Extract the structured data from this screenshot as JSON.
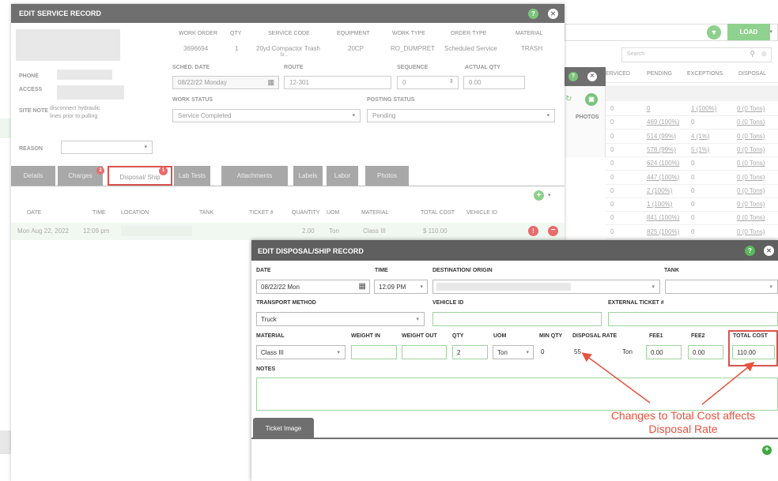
{
  "bg_panel": {
    "load_label": "LOAD",
    "search_placeholder": "Search",
    "columns": [
      "ERVICED",
      "PENDING",
      "EXCEPTIONS",
      "DISPOSAL"
    ],
    "photos_label": "PHOTOS",
    "rows": [
      {
        "serviced": "0",
        "pending": "0",
        "exceptions": "1 (100%)",
        "disposal": "0 (0 Tons)"
      },
      {
        "serviced": "0",
        "pending": "469 (100%)",
        "exceptions": "0",
        "disposal": "0 (0 Tons)"
      },
      {
        "serviced": "0",
        "pending": "514 (99%)",
        "exceptions": "4 (1%)",
        "disposal": "0 (0 Tons)"
      },
      {
        "serviced": "0",
        "pending": "578 (99%)",
        "exceptions": "5 (1%)",
        "disposal": "0 (0 Tons)"
      },
      {
        "serviced": "0",
        "pending": "624 (100%)",
        "exceptions": "0",
        "disposal": "0 (0 Tons)"
      },
      {
        "serviced": "0",
        "pending": "447 (100%)",
        "exceptions": "0",
        "disposal": "0 (0 Tons)"
      },
      {
        "serviced": "0",
        "pending": "2 (100%)",
        "exceptions": "0",
        "disposal": "0 (0 Tons)"
      },
      {
        "serviced": "0",
        "pending": "1 (100%)",
        "exceptions": "0",
        "disposal": "0 (0 Tons)"
      },
      {
        "serviced": "0",
        "pending": "841 (100%)",
        "exceptions": "0",
        "disposal": "0 (0 Tons)"
      },
      {
        "serviced": "0",
        "pending": "825 (100%)",
        "exceptions": "0",
        "disposal": "0 (0 Tons)"
      }
    ]
  },
  "service_record": {
    "title": "EDIT SERVICE RECORD",
    "help": "?",
    "close": "✕",
    "headers": {
      "work_order": "WORK ORDER",
      "qty": "QTY",
      "service_code": "SERVICE CODE",
      "equipment": "EQUIPMENT",
      "work_type": "WORK TYPE",
      "order_type": "ORDER TYPE",
      "material": "MATERIAL"
    },
    "values": {
      "work_order": "3696694",
      "qty": "1",
      "service_code": "20yd Compactor Trash",
      "service_code_2": "Sr...",
      "equipment": "20CP",
      "work_type": "RO_DUMPRET",
      "order_type": "Scheduled Service",
      "material": "TRASH"
    },
    "phone_label": "PHONE",
    "access_label": "ACCESS",
    "site_note_label": "SITE NOTE",
    "site_note_1": "disconnect hydraulic",
    "site_note_2": "lines prior to pulling",
    "reason_label": "REASON",
    "sched_date_label": "SCHED. DATE",
    "sched_date": "08/22/22 Monday",
    "route_label": "ROUTE",
    "route": "12-301",
    "sequence_label": "SEQUENCE",
    "sequence": "0",
    "actual_qty_label": "ACTUAL QTY",
    "actual_qty": "0.00",
    "work_status_label": "WORK STATUS",
    "work_status": "Service Completed",
    "posting_status_label": "POSTING STATUS",
    "posting_status": "Pending",
    "tabs": [
      {
        "label": "Details"
      },
      {
        "label": "Charges",
        "badge": "2"
      },
      {
        "label": "Disposal/ Ship",
        "badge": "1"
      },
      {
        "label": "Lab Tests"
      },
      {
        "label": "Attachments"
      },
      {
        "label": "Labels"
      },
      {
        "label": "Labor"
      },
      {
        "label": "Photos"
      }
    ],
    "table": {
      "headers": [
        "DATE",
        "TIME",
        "LOCATION",
        "TANK",
        "TICKET #",
        "QUANTITY",
        "UOM",
        "MATERIAL",
        "TOTAL COST",
        "VEHICLE ID"
      ],
      "row": {
        "date": "Mon Aug 22, 2022",
        "time": "12:09 pm",
        "quantity": "2.00",
        "uom": "Ton",
        "material": "Class III",
        "total_cost": "$ 110.00"
      }
    }
  },
  "disposal_record": {
    "title": "EDIT DISPOSAL/SHIP RECORD",
    "help": "?",
    "close": "✕",
    "date_label": "DATE",
    "date": "08/22/22 Mon",
    "time_label": "TIME",
    "time": "12:09 PM",
    "destination_label": "DESTINATION/ ORIGIN",
    "tank_label": "TANK",
    "transport_label": "TRANSPORT METHOD",
    "transport": "Truck",
    "vehicle_label": "VEHICLE ID",
    "external_ticket_label": "EXTERNAL TICKET #",
    "material_label": "MATERIAL",
    "material": "Class III",
    "weight_in_label": "WEIGHT IN",
    "weight_out_label": "WEIGHT OUT",
    "qty_label": "QTY",
    "qty": "2",
    "uom_label": "UOM",
    "uom": "Ton",
    "min_qty_label": "MIN QTY",
    "min_qty": "0",
    "disposal_rate_label": "DISPOSAL RATE",
    "disposal_rate": "55",
    "rate_unit": "Ton",
    "fee1_label": "FEE1",
    "fee1": "0.00",
    "fee2_label": "FEE2",
    "fee2": "0.00",
    "total_cost_label": "TOTAL COST",
    "total_cost": "110.00",
    "notes_label": "NOTES",
    "ticket_image_tab": "Ticket Image"
  },
  "annotation": {
    "line1": "Changes to Total Cost affects",
    "line2": "Disposal Rate",
    "color": "#e8523f"
  }
}
